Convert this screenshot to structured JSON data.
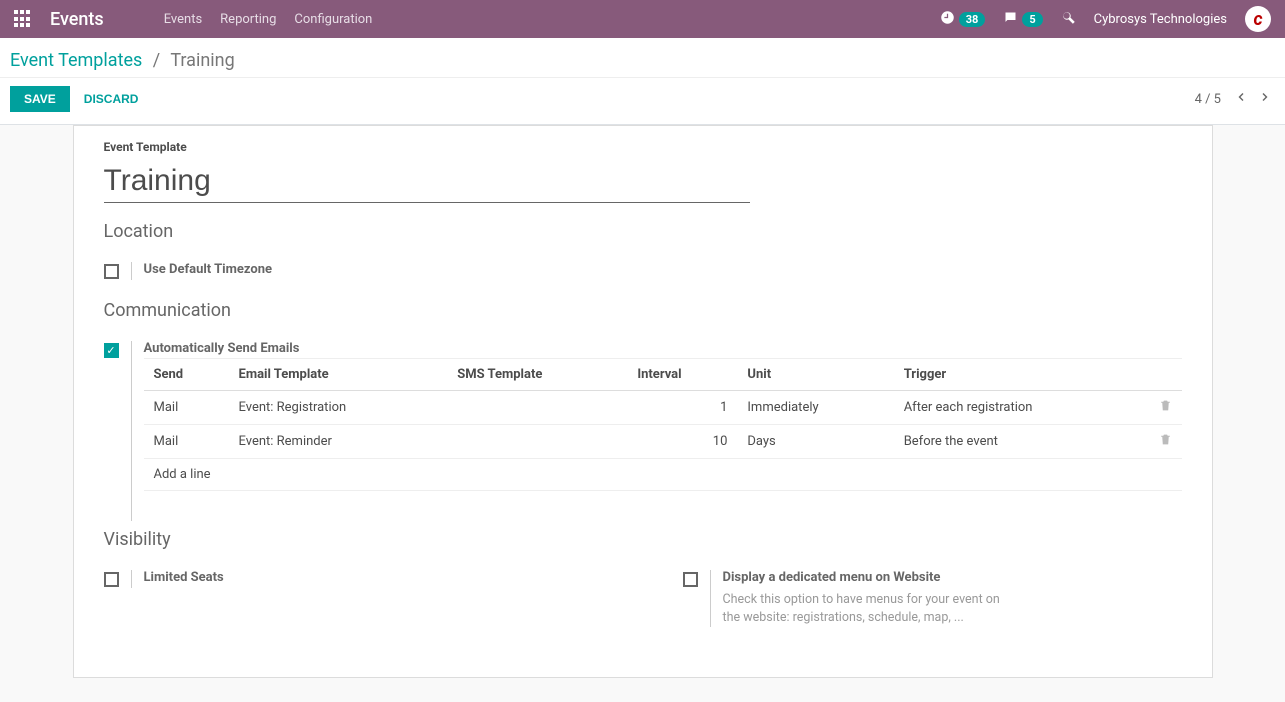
{
  "header": {
    "app_title": "Events",
    "menu": [
      "Events",
      "Reporting",
      "Configuration"
    ],
    "activity_count": "38",
    "message_count": "5",
    "company_name": "Cybrosys Technologies"
  },
  "breadcrumb": {
    "parent": "Event Templates",
    "current": "Training"
  },
  "actions": {
    "save": "SAVE",
    "discard": "DISCARD"
  },
  "pager": {
    "text": "4 / 5"
  },
  "form": {
    "template_label": "Event Template",
    "title_value": "Training",
    "section_location": "Location",
    "opt_timezone": "Use Default Timezone",
    "section_communication": "Communication",
    "opt_autosend": "Automatically Send Emails",
    "table": {
      "headers": {
        "send": "Send",
        "email_template": "Email Template",
        "sms_template": "SMS Template",
        "interval": "Interval",
        "unit": "Unit",
        "trigger": "Trigger"
      },
      "rows": [
        {
          "send": "Mail",
          "email_template": "Event: Registration",
          "sms_template": "",
          "interval": "1",
          "unit": "Immediately",
          "trigger": "After each registration"
        },
        {
          "send": "Mail",
          "email_template": "Event: Reminder",
          "sms_template": "",
          "interval": "10",
          "unit": "Days",
          "trigger": "Before the event"
        }
      ],
      "add_line": "Add a line"
    },
    "section_visibility": "Visibility",
    "opt_limited_seats": "Limited Seats",
    "opt_dedicated_menu": "Display a dedicated menu on Website",
    "opt_dedicated_menu_help": "Check this option to have menus for your event on the website: registrations, schedule, map, ..."
  }
}
